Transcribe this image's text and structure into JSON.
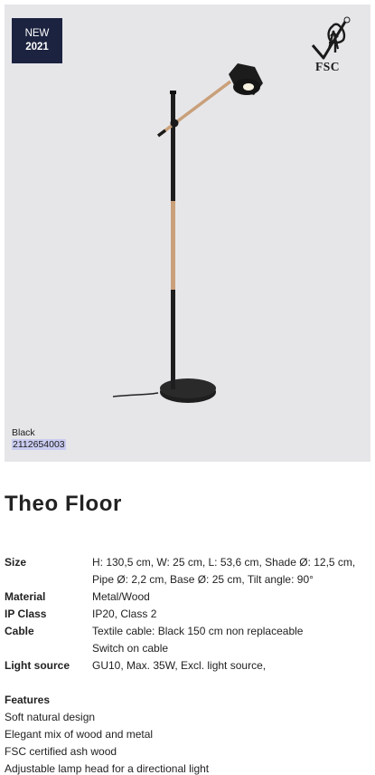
{
  "hero": {
    "badge_line1": "NEW",
    "badge_line2": "2021",
    "fsc_text": "FSC",
    "color_label": "Black",
    "sku": "2112654003"
  },
  "product": {
    "title": "Theo Floor"
  },
  "specs": [
    {
      "label": "Size",
      "lines": [
        "H: 130,5 cm, W: 25 cm, L: 53,6 cm, Shade Ø: 12,5 cm,",
        "Pipe Ø: 2,2 cm, Base Ø: 25 cm, Tilt angle: 90°"
      ]
    },
    {
      "label": "Material",
      "lines": [
        "Metal/Wood"
      ]
    },
    {
      "label": "IP Class",
      "lines": [
        "IP20, Class 2"
      ]
    },
    {
      "label": "Cable",
      "lines": [
        "Textile cable: Black 150 cm non replaceable",
        "Switch on cable"
      ]
    },
    {
      "label": "Light source",
      "lines": [
        "GU10, Max. 35W, Excl. light source,"
      ]
    }
  ],
  "features": {
    "title": "Features",
    "items": [
      "Soft natural design",
      "Elegant mix of wood and metal",
      "FSC certified ash wood",
      "Adjustable lamp head for a directional light"
    ]
  }
}
